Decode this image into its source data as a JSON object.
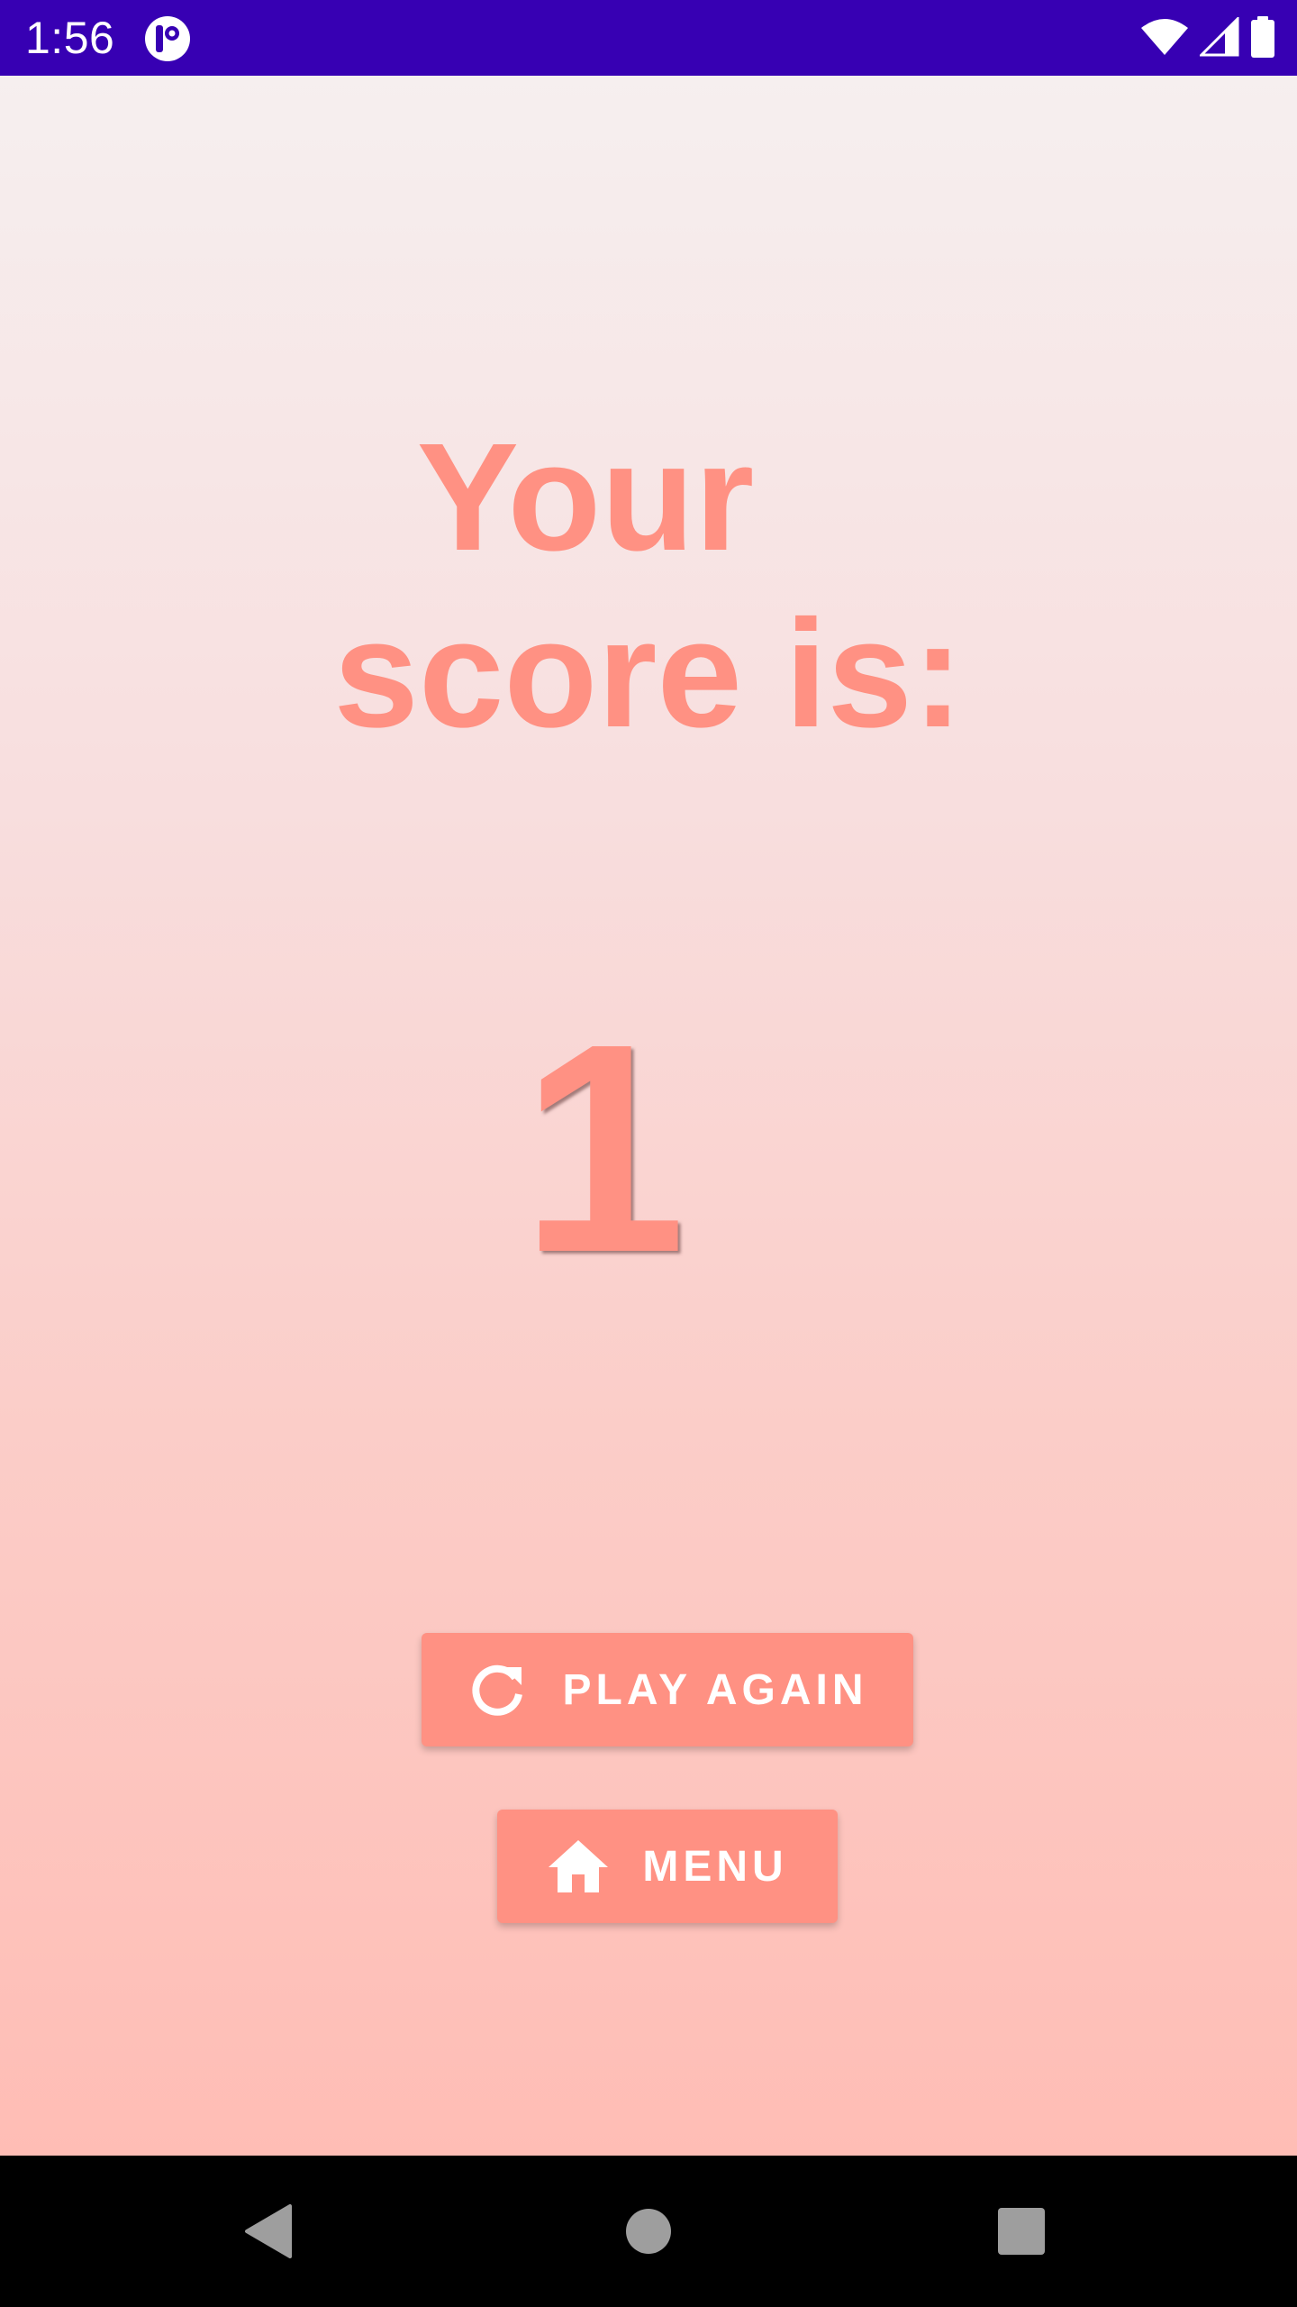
{
  "status_bar": {
    "time": "1:56",
    "background_color": "#3700b3",
    "icons": [
      "app-notification-icon",
      "wifi-icon",
      "cellular-signal-icon",
      "battery-icon"
    ]
  },
  "main": {
    "heading_line1": "Your",
    "heading_line2": "score is:",
    "score": "1",
    "accent_color": "#ff9183",
    "buttons": {
      "play_again_label": "PLAY AGAIN",
      "play_again_icon": "refresh-icon",
      "menu_label": "MENU",
      "menu_icon": "home-icon"
    }
  },
  "nav_bar": {
    "icons": [
      "back-icon",
      "home-circle-icon",
      "recents-icon"
    ]
  }
}
